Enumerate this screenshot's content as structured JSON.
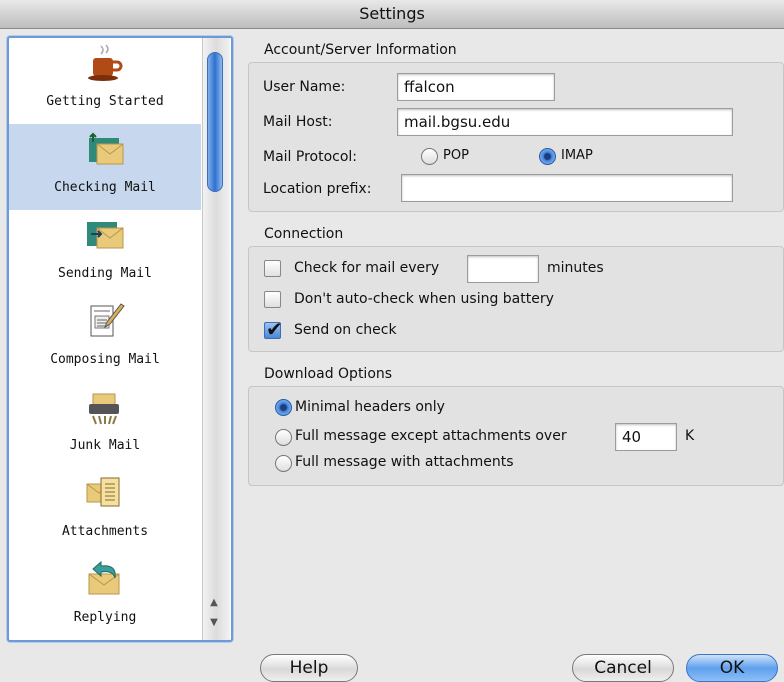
{
  "window": {
    "title": "Settings"
  },
  "sidebar": {
    "items": [
      {
        "label": "Getting Started",
        "icon": "coffee-cup-icon"
      },
      {
        "label": "Checking Mail",
        "icon": "check-mail-icon",
        "selected": true
      },
      {
        "label": "Sending Mail",
        "icon": "send-mail-icon"
      },
      {
        "label": "Composing Mail",
        "icon": "compose-mail-icon"
      },
      {
        "label": "Junk Mail",
        "icon": "junk-mail-icon"
      },
      {
        "label": "Attachments",
        "icon": "attachments-icon"
      },
      {
        "label": "Replying",
        "icon": "replying-icon"
      }
    ],
    "scroll_up": "▲",
    "scroll_down": "▼"
  },
  "account": {
    "title": "Account/Server Information",
    "user_name_label": "User Name:",
    "user_name_value": "ffalcon",
    "mail_host_label": "Mail Host:",
    "mail_host_value": "mail.bgsu.edu",
    "protocol_label": "Mail Protocol:",
    "protocol_pop": "POP",
    "protocol_imap": "IMAP",
    "protocol_selected": "IMAP",
    "location_prefix_label": "Location prefix:",
    "location_prefix_value": ""
  },
  "connection": {
    "title": "Connection",
    "check_every_label": "Check for mail every",
    "check_every_value": "",
    "check_every_unit": "minutes",
    "check_every_checked": false,
    "battery_label": "Don't auto-check when using battery",
    "battery_checked": false,
    "send_on_check_label": "Send on check",
    "send_on_check_checked": true,
    "checkmark": "✔"
  },
  "download": {
    "title": "Download Options",
    "option_minimal": "Minimal headers only",
    "option_except": "Full message except attachments over",
    "except_value": "40",
    "except_unit": "K",
    "option_full": "Full message with attachments",
    "selected": "Minimal headers only"
  },
  "buttons": {
    "help": "Help",
    "cancel": "Cancel",
    "ok": "OK"
  },
  "colors": {
    "accent": "#3d7fda",
    "selection": "#c7d7ee",
    "sidebar_border": "#6d9ad6"
  }
}
